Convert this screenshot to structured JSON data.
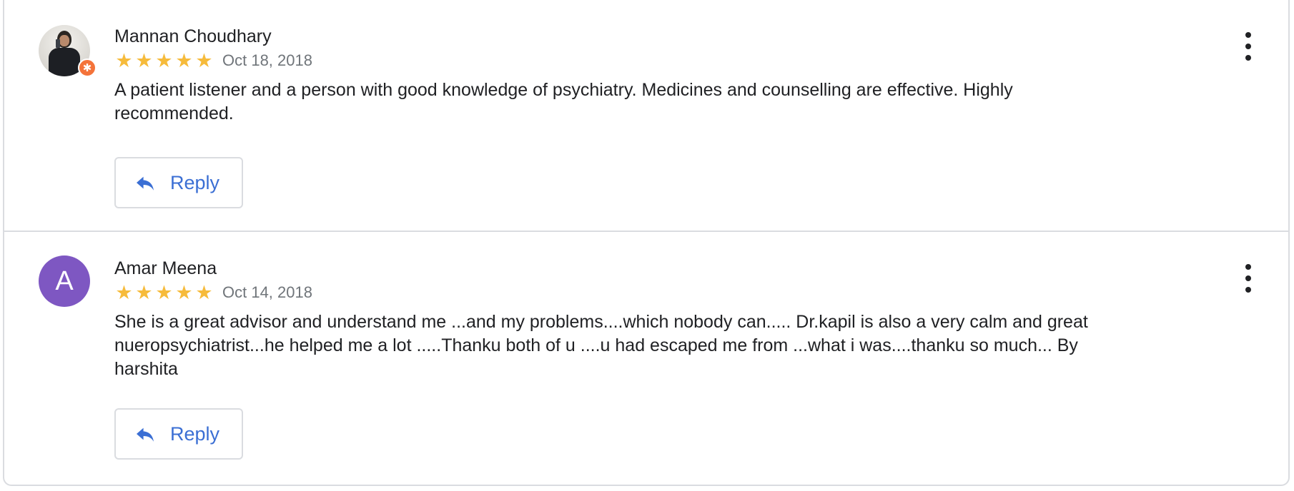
{
  "reviews": [
    {
      "author": "Mannan Choudhary",
      "avatar_type": "photo",
      "badge_icon": "local-guide-badge-icon",
      "rating": 5,
      "date": "Oct 18, 2018",
      "text": "A patient listener and a person with good knowledge of psychiatry. Medicines and counselling are effective. Highly recommended.",
      "reply_label": "Reply"
    },
    {
      "author": "Amar Meena",
      "avatar_type": "letter",
      "avatar_letter": "A",
      "avatar_color": "#7e57c2",
      "rating": 5,
      "date": "Oct 14, 2018",
      "text": "She is a great advisor and understand me ...and my problems....which nobody can..... Dr.kapil is also a very calm and great nueropsychiatrist...he helped me a lot .....Thanku both of u ....u had escaped me from ...what i was....thanku so much... By harshita",
      "reply_label": "Reply"
    }
  ],
  "colors": {
    "star": "#f6bb3b",
    "reply_accent": "#3b6fd4",
    "border": "#dadce0",
    "date": "#70757a"
  },
  "icons": {
    "reply": "reply-arrow-icon",
    "more": "more-vert-icon",
    "star": "star-icon"
  }
}
